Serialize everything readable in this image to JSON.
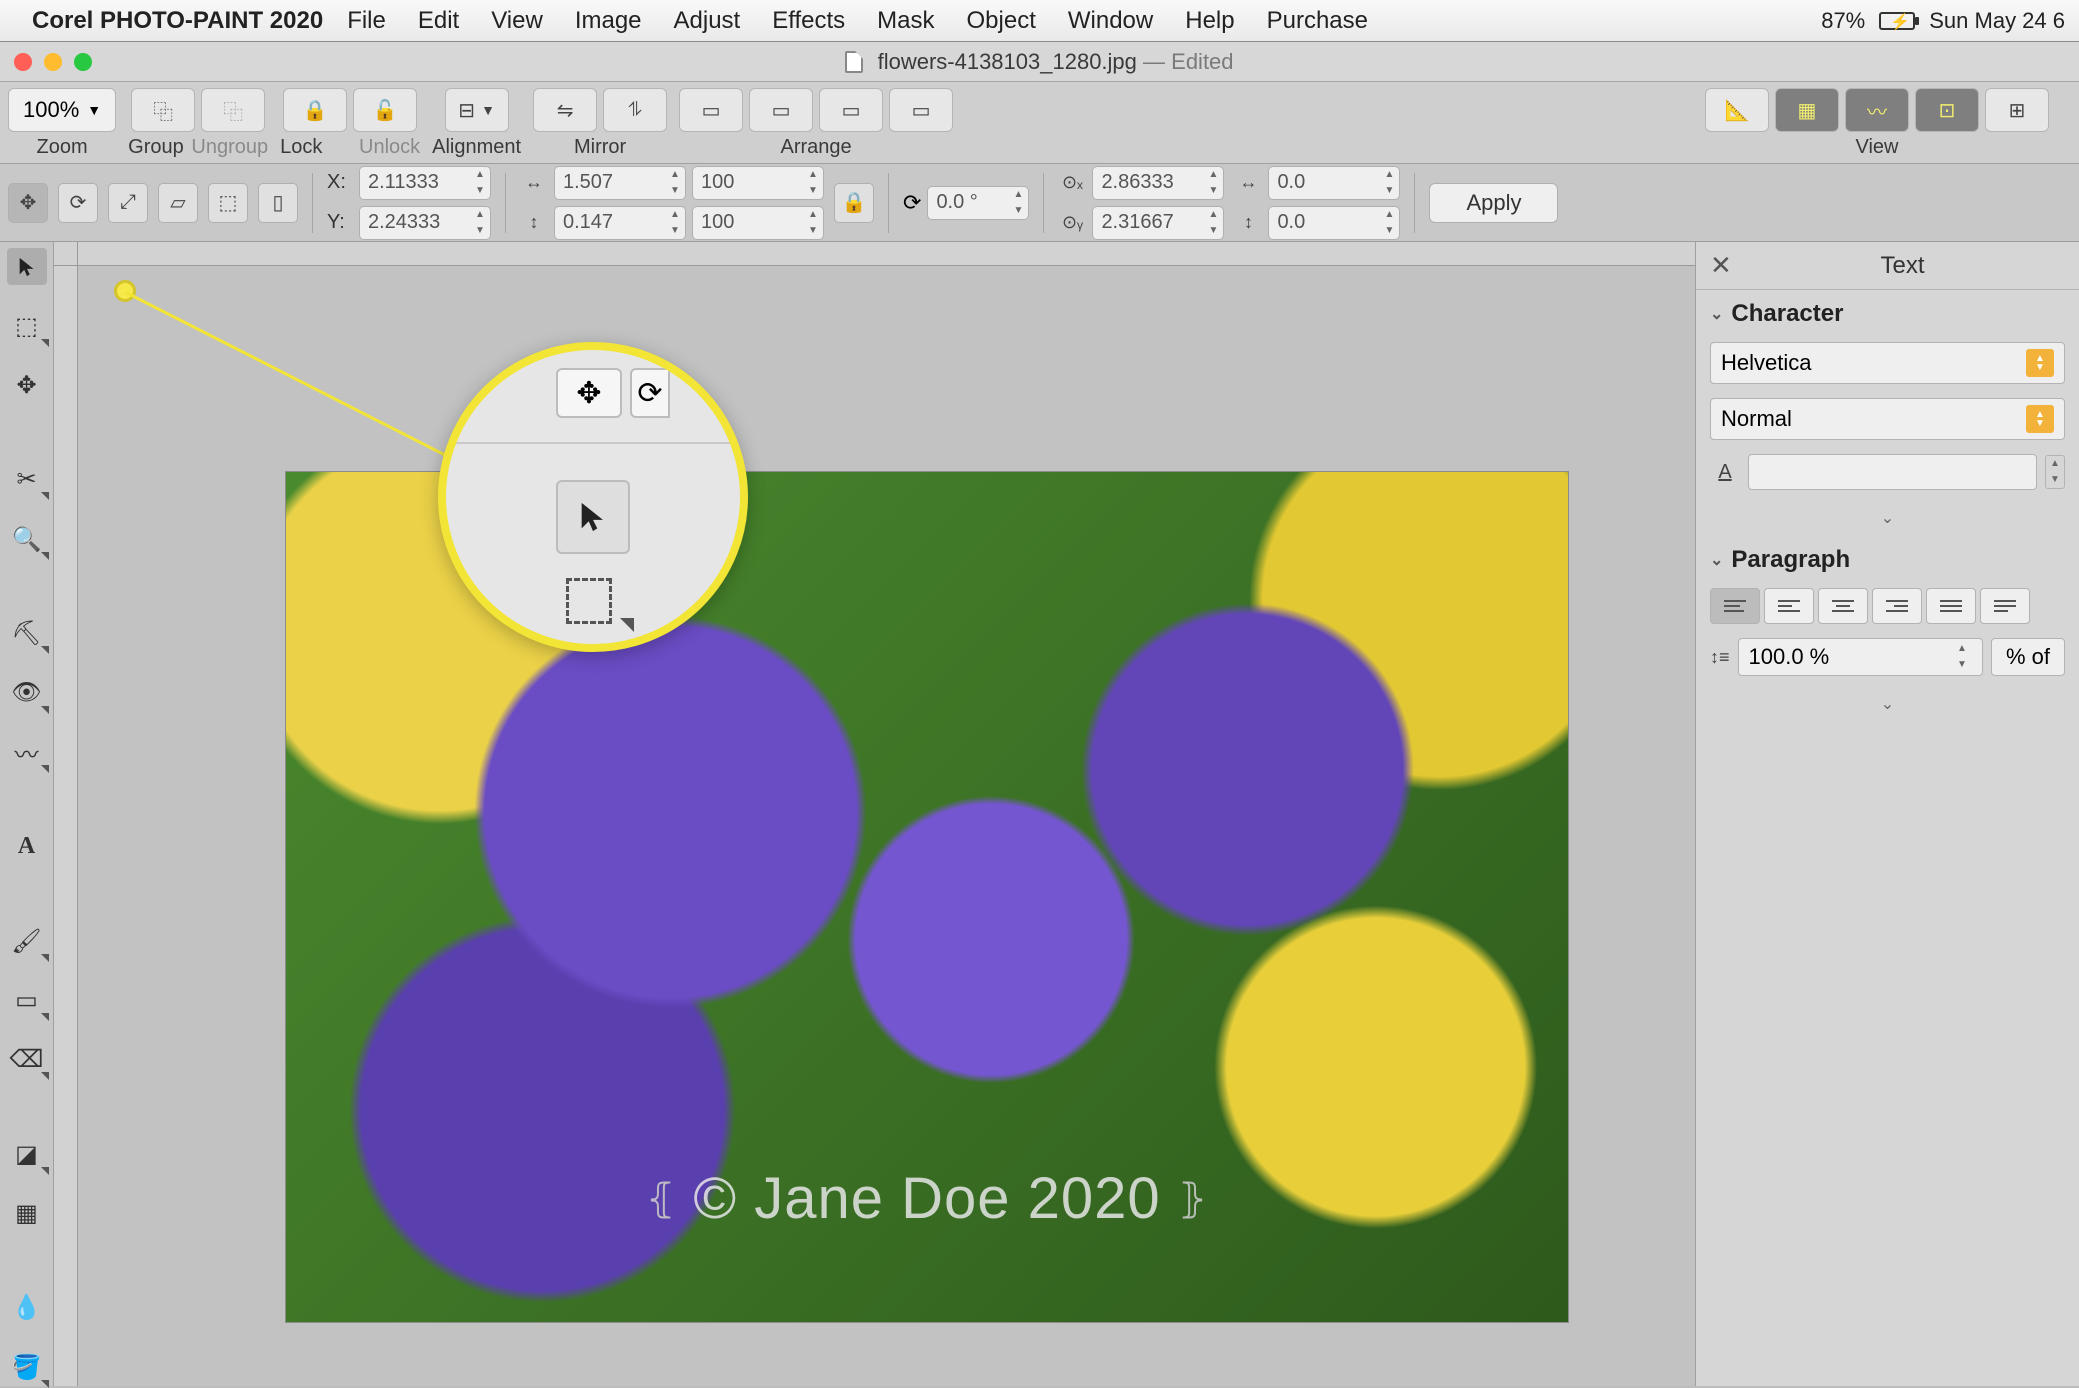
{
  "mac_menu": {
    "app_name": "Corel PHOTO-PAINT 2020",
    "items": [
      "File",
      "Edit",
      "View",
      "Image",
      "Adjust",
      "Effects",
      "Mask",
      "Object",
      "Window",
      "Help",
      "Purchase"
    ],
    "battery": "87%",
    "clock": "Sun May 24  6"
  },
  "titlebar": {
    "filename": "flowers-4138103_1280.jpg",
    "status": "— Edited"
  },
  "toolbar": {
    "zoom": {
      "value": "100%",
      "label": "Zoom"
    },
    "group": {
      "group": "Group",
      "ungroup": "Ungroup"
    },
    "lock": {
      "lock": "Lock",
      "unlock": "Unlock"
    },
    "alignment": {
      "label": "Alignment"
    },
    "mirror": {
      "label": "Mirror"
    },
    "arrange": {
      "label": "Arrange"
    },
    "view": {
      "label": "View"
    }
  },
  "propbar": {
    "x": "2.11333",
    "y": "2.24333",
    "w": "1.507",
    "h": "0.147",
    "sx": "100",
    "sy": "100",
    "rot": "0.0 °",
    "cx": "2.86333",
    "cy": "2.31667",
    "skx": "0.0",
    "sky": "0.0",
    "apply": "Apply",
    "xlabel": "X:",
    "ylabel": "Y:"
  },
  "canvas": {
    "watermark": "© Jane Doe 2020"
  },
  "docker": {
    "title": "Text",
    "character": {
      "title": "Character",
      "font": "Helvetica",
      "style": "Normal"
    },
    "paragraph": {
      "title": "Paragraph",
      "spacing": "100.0 %",
      "spacing_unit": "% of"
    }
  }
}
